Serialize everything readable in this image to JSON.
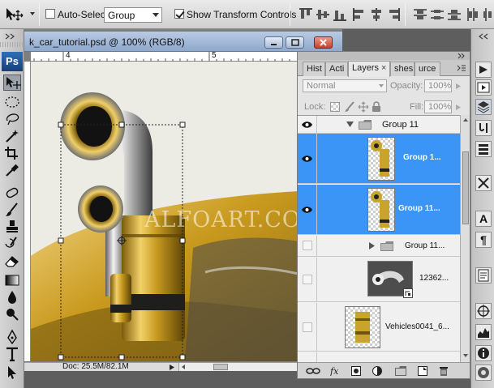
{
  "options_bar": {
    "auto_select_label": "Auto-Select:",
    "auto_select_checked": false,
    "auto_select_value": "Group",
    "show_transform_label": "Show Transform Controls",
    "show_transform_checked": true
  },
  "tools_panel": {
    "logo_text": "Ps",
    "tools": [
      "move-tool",
      "marquee-tool",
      "lasso-tool",
      "magic-wand-tool",
      "crop-tool",
      "eyedropper-tool",
      "healing-brush-tool",
      "brush-tool",
      "clone-stamp-tool",
      "history-brush-tool",
      "eraser-tool",
      "gradient-tool",
      "blur-tool",
      "dodge-tool",
      "pen-tool",
      "type-tool",
      "path-selection-tool"
    ]
  },
  "document": {
    "title": "k_car_tutorial.psd @ 100% (RGB/8)",
    "ruler_labels": [
      "4",
      "5"
    ],
    "watermark": "ALFOART.COM",
    "status_doc": "Doc: 25.5M/82.1M"
  },
  "layers_panel": {
    "tabs": [
      {
        "label": "Hist",
        "active": false
      },
      {
        "label": "Acti",
        "active": false
      },
      {
        "label": "Layers",
        "active": true
      },
      {
        "label": "shes",
        "active": false
      },
      {
        "label": "urce",
        "active": false
      }
    ],
    "close_glyph": "×",
    "blend_mode": "Normal",
    "opacity_label": "Opacity:",
    "opacity_value": "100%",
    "lock_label": "Lock:",
    "fill_label": "Fill:",
    "fill_value": "100%",
    "layers": [
      {
        "name": "Group 11",
        "visible": true,
        "selected": false,
        "kind": "group-open"
      },
      {
        "name": "Group 1...",
        "visible": true,
        "selected": true,
        "kind": "layer"
      },
      {
        "name": "Group 11...",
        "visible": true,
        "selected": true,
        "kind": "layer"
      },
      {
        "name": "Group 11...",
        "visible": false,
        "selected": false,
        "kind": "group-closed"
      },
      {
        "name": "12362...",
        "visible": false,
        "selected": false,
        "kind": "smart"
      },
      {
        "name": "Vehicles0041_6...",
        "visible": false,
        "selected": false,
        "kind": "layer"
      }
    ],
    "footer_icons": [
      "link-layers-icon",
      "layer-style-icon",
      "layer-mask-icon",
      "adjustment-layer-icon",
      "new-group-icon",
      "new-layer-icon",
      "delete-layer-icon"
    ]
  },
  "right_dock": {
    "icons": [
      "panel-expand-icon",
      "actions-icon",
      "play-icon",
      "layers-stack-icon",
      "tool-presets-icon",
      "channels-icon",
      "brush-presets-icon",
      "character-icon",
      "paragraph-icon",
      "notes-icon",
      "navigator-icon",
      "histogram-icon",
      "info-icon",
      "color-swatches-icon"
    ],
    "character_glyph": "A",
    "paragraph_glyph": "¶"
  },
  "colors": {
    "selection_blue": "#3b95f6",
    "title_bar": "#a3b9d7",
    "gold": "#c9a42c"
  }
}
